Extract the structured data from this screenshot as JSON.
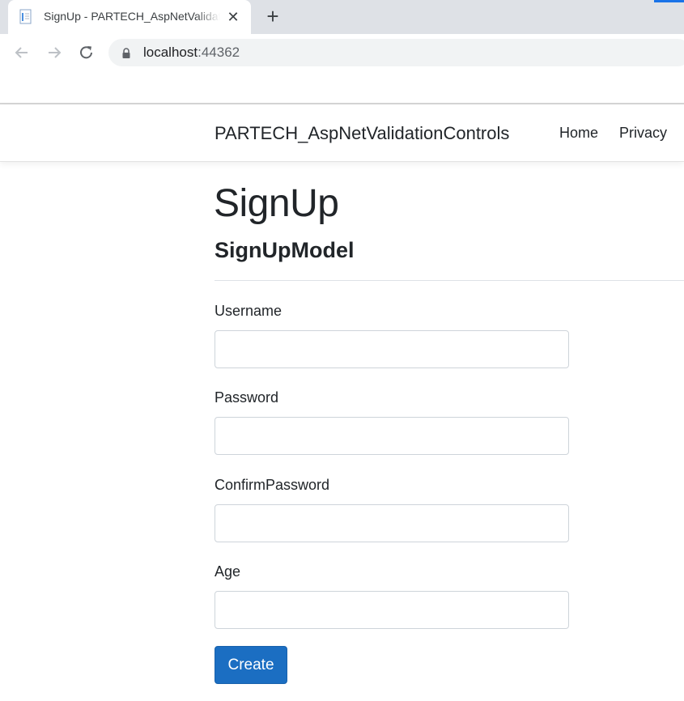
{
  "browser": {
    "tab_title": "SignUp - PARTECH_AspNetValidationControls",
    "tab_close_glyph": "✕",
    "new_tab_glyph": "+",
    "url_host": "localhost",
    "url_port": ":44362",
    "accent_color": "#1a73e8"
  },
  "navbar": {
    "brand": "PARTECH_AspNetValidationControls",
    "links": [
      "Home",
      "Privacy"
    ]
  },
  "page": {
    "title": "SignUp",
    "subtitle": "SignUpModel"
  },
  "form": {
    "fields": [
      {
        "label": "Username",
        "value": "",
        "placeholder": ""
      },
      {
        "label": "Password",
        "value": "",
        "placeholder": ""
      },
      {
        "label": "ConfirmPassword",
        "value": "",
        "placeholder": ""
      },
      {
        "label": "Age",
        "value": "",
        "placeholder": ""
      }
    ],
    "submit_label": "Create"
  },
  "colors": {
    "primary_button": "#1b6ec2",
    "text": "#212529"
  },
  "icons": {
    "tab_favicon": "document-icon",
    "back": "arrow-left-icon",
    "forward": "arrow-right-icon",
    "reload": "reload-icon",
    "secure": "lock-icon"
  }
}
